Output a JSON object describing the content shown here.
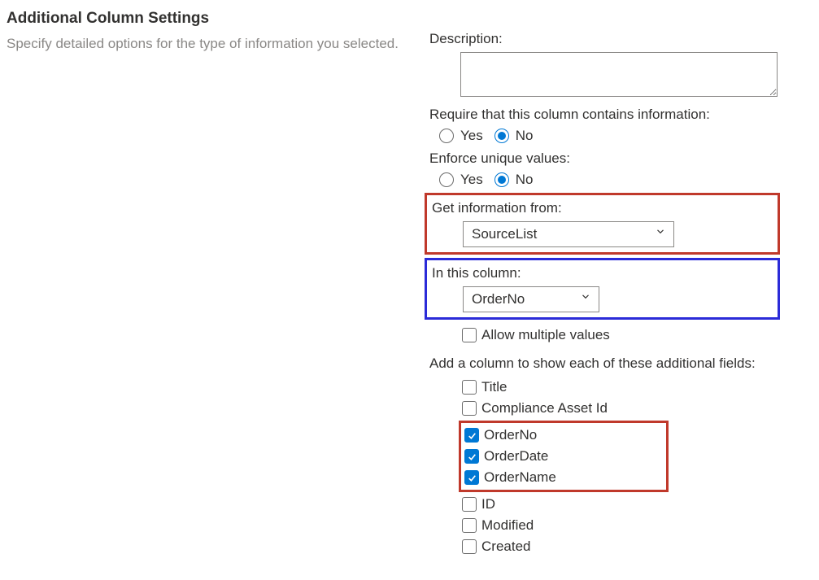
{
  "left": {
    "title": "Additional Column Settings",
    "description": "Specify detailed options for the type of information you selected."
  },
  "right": {
    "description_label": "Description:",
    "description_value": "",
    "require_label": "Require that this column contains information:",
    "require_yes": "Yes",
    "require_no": "No",
    "require_selected": "No",
    "unique_label": "Enforce unique values:",
    "unique_yes": "Yes",
    "unique_no": "No",
    "unique_selected": "No",
    "get_info_label": "Get information from:",
    "get_info_value": "SourceList",
    "in_column_label": "In this column:",
    "in_column_value": "OrderNo",
    "allow_multi_label": "Allow multiple values",
    "allow_multi_checked": false,
    "additional_label": "Add a column to show each of these additional fields:",
    "fields": [
      {
        "label": "Title",
        "checked": false
      },
      {
        "label": "Compliance Asset Id",
        "checked": false
      },
      {
        "label": "OrderNo",
        "checked": true
      },
      {
        "label": "OrderDate",
        "checked": true
      },
      {
        "label": "OrderName",
        "checked": true
      },
      {
        "label": "ID",
        "checked": false
      },
      {
        "label": "Modified",
        "checked": false
      },
      {
        "label": "Created",
        "checked": false
      }
    ]
  }
}
